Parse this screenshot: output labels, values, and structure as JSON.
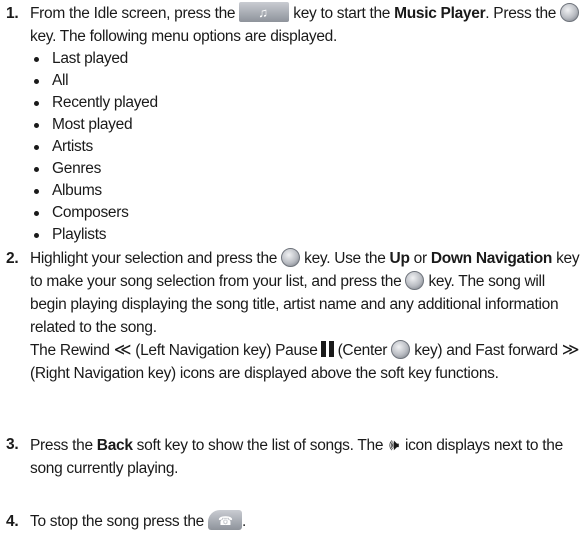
{
  "steps": [
    {
      "number": "1.",
      "t1": "From the Idle screen, press the",
      "t2": "key to start the",
      "b1": "Music Player",
      "t3": ". Press the",
      "t4": "key. The following menu options are displayed.",
      "options": [
        "Last played",
        "All",
        "Recently played",
        "Most played",
        "Artists",
        "Genres",
        "Albums",
        "Composers",
        "Playlists"
      ]
    },
    {
      "number": "2.",
      "t1": "Highlight your selection and press the",
      "t2": "key. Use the",
      "b1": "Up",
      "t3": "or",
      "b2": "Down Navigation",
      "t4": "key to make your song selection from your list, and press the",
      "t5": "key. The song will begin playing displaying the song title, artist name and any additional information related to the song.",
      "t6": "The Rewind",
      "rewind_glyph": "≪",
      "t7": "(Left Navigation key) Pause",
      "t8": "(Center",
      "t9": "key) and Fast forward",
      "ff_glyph": "≫",
      "t10": "(Right Navigation key) icons are displayed above the soft key functions."
    },
    {
      "number": "3.",
      "t1": "Press the",
      "b1": "Back",
      "t2": "soft key to show the list of songs. The",
      "speaker_glyph": "🕪",
      "t3": "icon displays next to the song currently playing."
    },
    {
      "number": "4.",
      "t1": "To stop the song press the",
      "t2": "."
    }
  ]
}
